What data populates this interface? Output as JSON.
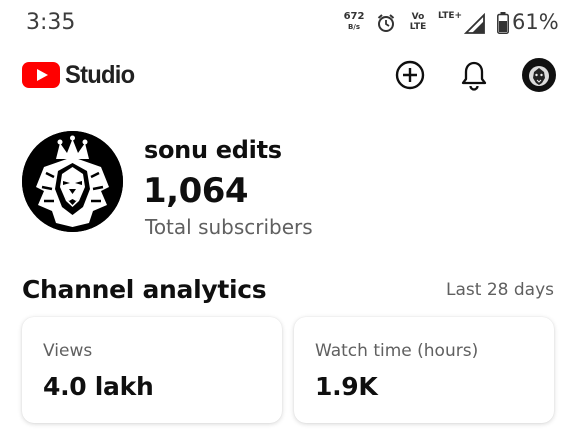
{
  "status_bar": {
    "time": "3:35",
    "net_speed_value": "672",
    "net_speed_unit": "B/s",
    "volte_line1": "Vo",
    "volte_line2": "LTE",
    "signal_label": "LTE+",
    "battery_percent": "61%",
    "icons": [
      "alarm-icon",
      "signal-icon",
      "battery-icon"
    ]
  },
  "app_bar": {
    "logo_text": "Studio",
    "brand_color": "#ff0000",
    "icons": [
      "create-icon",
      "notifications-bell-icon",
      "account-avatar"
    ]
  },
  "channel": {
    "name": "sonu edits",
    "subscriber_count": "1,064",
    "subscriber_label": "Total subscribers"
  },
  "analytics": {
    "title": "Channel analytics",
    "period": "Last 28 days",
    "cards": [
      {
        "label": "Views",
        "value": "4.0 lakh"
      },
      {
        "label": "Watch time (hours)",
        "value": "1.9K"
      }
    ]
  }
}
